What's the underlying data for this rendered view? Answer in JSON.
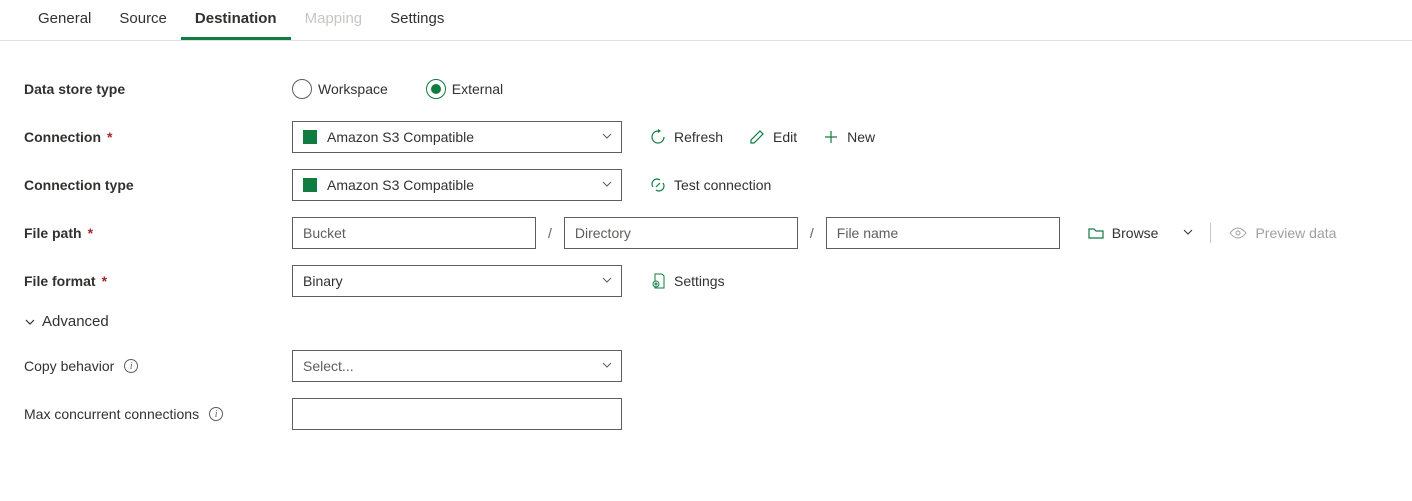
{
  "tabs": {
    "general": "General",
    "source": "Source",
    "destination": "Destination",
    "mapping": "Mapping",
    "settings": "Settings"
  },
  "labels": {
    "data_store_type": "Data store type",
    "connection": "Connection",
    "connection_type": "Connection type",
    "file_path": "File path",
    "file_format": "File format",
    "advanced": "Advanced",
    "copy_behavior": "Copy behavior",
    "max_concurrent": "Max concurrent connections"
  },
  "data_store": {
    "workspace": "Workspace",
    "external": "External"
  },
  "connection": {
    "selected": "Amazon S3 Compatible",
    "refresh": "Refresh",
    "edit": "Edit",
    "new": "New"
  },
  "connection_type": {
    "selected": "Amazon S3 Compatible",
    "test": "Test connection"
  },
  "file_path": {
    "bucket_ph": "Bucket",
    "directory_ph": "Directory",
    "filename_ph": "File name",
    "browse": "Browse",
    "preview": "Preview data"
  },
  "file_format": {
    "selected": "Binary",
    "settings": "Settings"
  },
  "copy_behavior": {
    "placeholder": "Select..."
  }
}
